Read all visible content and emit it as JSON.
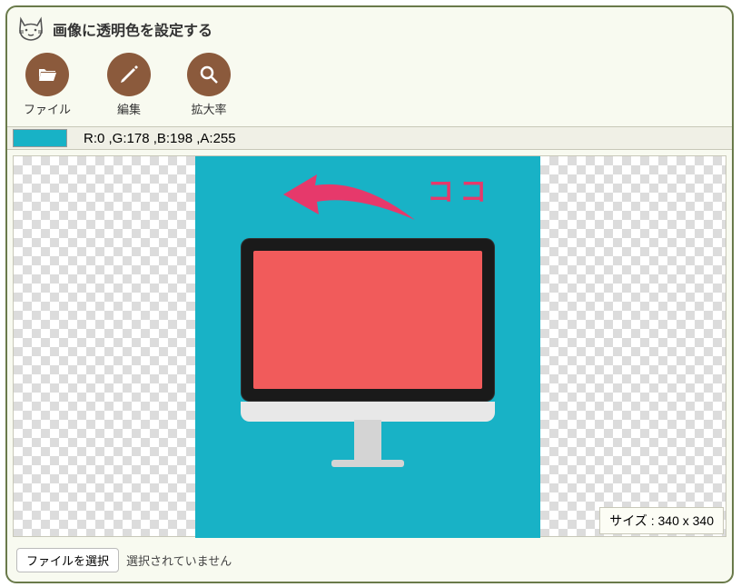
{
  "header": {
    "title": "画像に透明色を設定する"
  },
  "toolbar": {
    "items": [
      {
        "label": "ファイル",
        "icon": "folder-open-icon"
      },
      {
        "label": "編集",
        "icon": "pencil-icon"
      },
      {
        "label": "拡大率",
        "icon": "magnify-icon"
      }
    ]
  },
  "color_info": {
    "swatch": "#18B2C6",
    "text": "R:0 ,G:178 ,B:198 ,A:255"
  },
  "annotation": {
    "text": "ココ"
  },
  "size_badge": {
    "text": "サイズ : 340 x 340"
  },
  "footer": {
    "button": "ファイルを選択",
    "status": "選択されていません"
  }
}
